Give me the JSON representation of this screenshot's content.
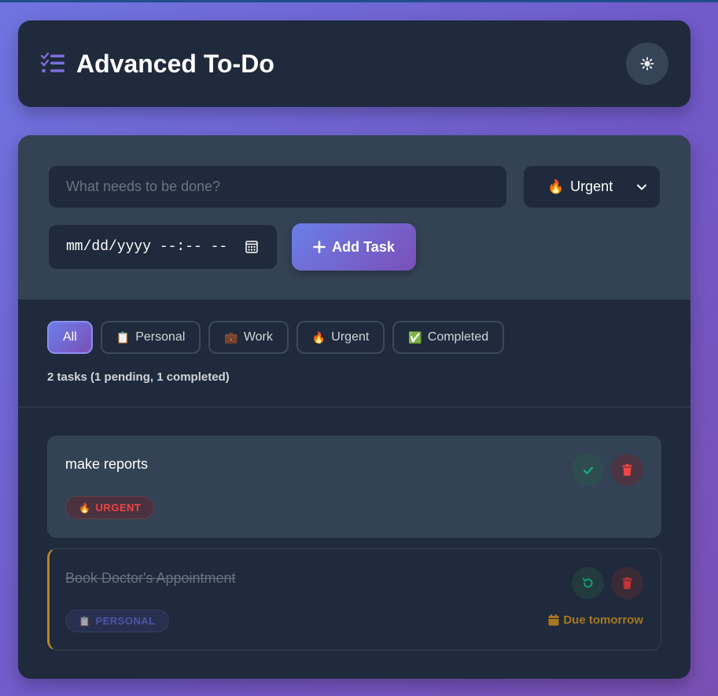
{
  "app": {
    "title": "Advanced To-Do"
  },
  "colors": {
    "accent_start": "#6a7fe8",
    "accent_end": "#7c4fb8",
    "urgent": "#ef4444",
    "complete": "#10b981",
    "due": "#a8761f"
  },
  "form": {
    "task_placeholder": "What needs to be done?",
    "task_value": "",
    "priority_selected": "Urgent",
    "priority_icon": "🔥",
    "date_value": "mm/dd/yyyy --:-- --",
    "add_label": "Add Task"
  },
  "filters": [
    {
      "label": "All",
      "icon": "",
      "active": true
    },
    {
      "label": "Personal",
      "icon": "📋",
      "active": false
    },
    {
      "label": "Work",
      "icon": "💼",
      "active": false
    },
    {
      "label": "Urgent",
      "icon": "🔥",
      "active": false
    },
    {
      "label": "Completed",
      "icon": "✅",
      "active": false
    }
  ],
  "stats": "2 tasks (1 pending, 1 completed)",
  "tasks": [
    {
      "text": "make reports",
      "category": "URGENT",
      "category_icon": "🔥",
      "completed": false,
      "due": ""
    },
    {
      "text": "Book Doctor's Appointment",
      "category": "PERSONAL",
      "category_icon": "📋",
      "completed": true,
      "due": "Due tomorrow"
    }
  ]
}
